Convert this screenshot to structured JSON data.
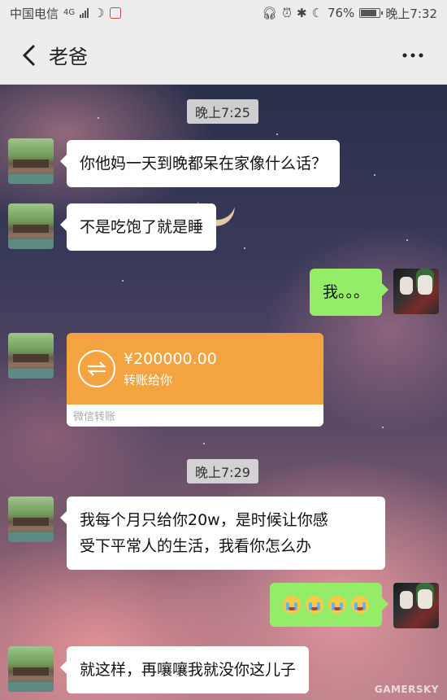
{
  "status_bar": {
    "carrier": "中国电信",
    "network": "4G",
    "battery": "76%",
    "time": "晚上7:32"
  },
  "header": {
    "title": "老爸",
    "more_glyph": "···"
  },
  "messages": {
    "time1": "晚上7:25",
    "msg1": "你他妈一天到晚都呆在家像什么话？",
    "msg2": "不是吃饱了就是睡",
    "msg3": "我。。。",
    "transfer": {
      "amount": "¥200000.00",
      "caption": "转账给你",
      "footer": "微信转账"
    },
    "time2": "晚上7:29",
    "msg4_line1": "我每个月只给你20w，是时候让你感",
    "msg4_line2": "受下平常人的生活，我看你怎么办",
    "msg5_emoji": [
      "crying-face",
      "crying-face",
      "crying-face",
      "crying-face"
    ],
    "msg6": "就这样，再嚷嚷我就没你这儿子"
  },
  "watermark": "GAMERSKY",
  "colors": {
    "header_bg": "#ededed",
    "self_bubble": "#95ec69",
    "transfer_orange": "#f3a33f"
  }
}
